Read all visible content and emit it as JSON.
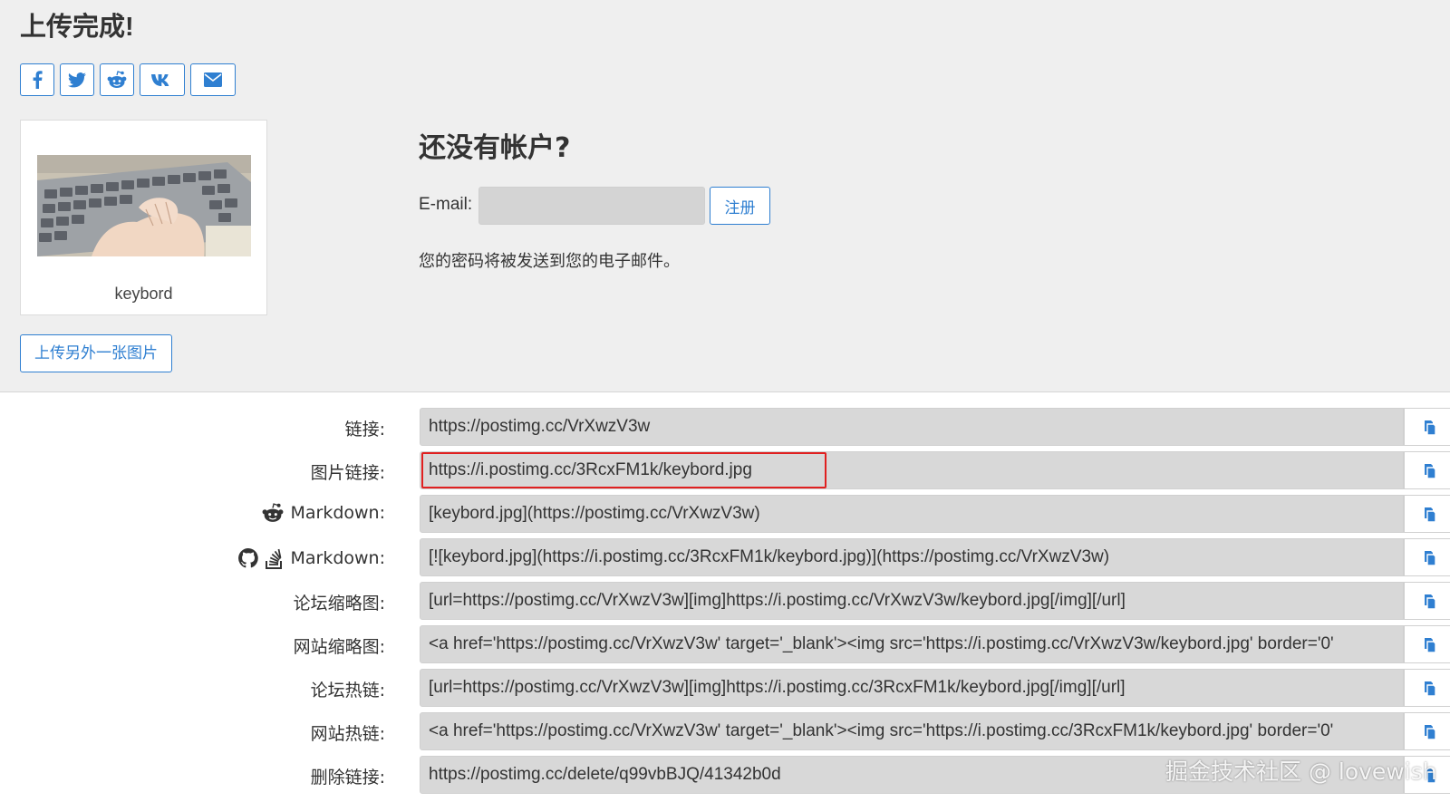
{
  "title": "上传完成!",
  "share_icons": [
    "facebook-icon",
    "twitter-icon",
    "reddit-icon",
    "vk-icon",
    "envelope-icon"
  ],
  "image": {
    "caption": "keybord"
  },
  "upload_another_label": "上传另外一张图片",
  "account": {
    "heading": "还没有帐户?",
    "email_label": "E-mail:",
    "email_value": "",
    "register_label": "注册",
    "note": "您的密码将被发送到您的电子邮件。"
  },
  "links": [
    {
      "label": "链接:",
      "value": "https://postimg.cc/VrXwzV3w"
    },
    {
      "label": "图片链接:",
      "value": "https://i.postimg.cc/3RcxFM1k/keybord.jpg"
    },
    {
      "label": "Markdown:",
      "icons": [
        "reddit-icon"
      ],
      "value": "[keybord.jpg](https://postimg.cc/VrXwzV3w)"
    },
    {
      "label": "Markdown:",
      "icons": [
        "github-icon",
        "stackoverflow-icon"
      ],
      "value": "[![keybord.jpg](https://i.postimg.cc/3RcxFM1k/keybord.jpg)](https://postimg.cc/VrXwzV3w)"
    },
    {
      "label": "论坛缩略图:",
      "value": "[url=https://postimg.cc/VrXwzV3w][img]https://i.postimg.cc/VrXwzV3w/keybord.jpg[/img][/url]"
    },
    {
      "label": "网站缩略图:",
      "value": "<a href='https://postimg.cc/VrXwzV3w' target='_blank'><img src='https://i.postimg.cc/VrXwzV3w/keybord.jpg' border='0'"
    },
    {
      "label": "论坛热链:",
      "value": "[url=https://postimg.cc/VrXwzV3w][img]https://i.postimg.cc/3RcxFM1k/keybord.jpg[/img][/url]"
    },
    {
      "label": "网站热链:",
      "value": "<a href='https://postimg.cc/VrXwzV3w' target='_blank'><img src='https://i.postimg.cc/3RcxFM1k/keybord.jpg' border='0'"
    },
    {
      "label": "删除链接:",
      "value": "https://postimg.cc/delete/q99vbBJQ/41342b0d"
    }
  ],
  "copy_icon": "copy-icon",
  "watermark": "掘金技术社区 @ lovewish",
  "colors": {
    "accent": "#2f7fd1",
    "highlight": "#e02020",
    "field_bg": "#d8d8d8",
    "top_bg": "#efefef"
  }
}
